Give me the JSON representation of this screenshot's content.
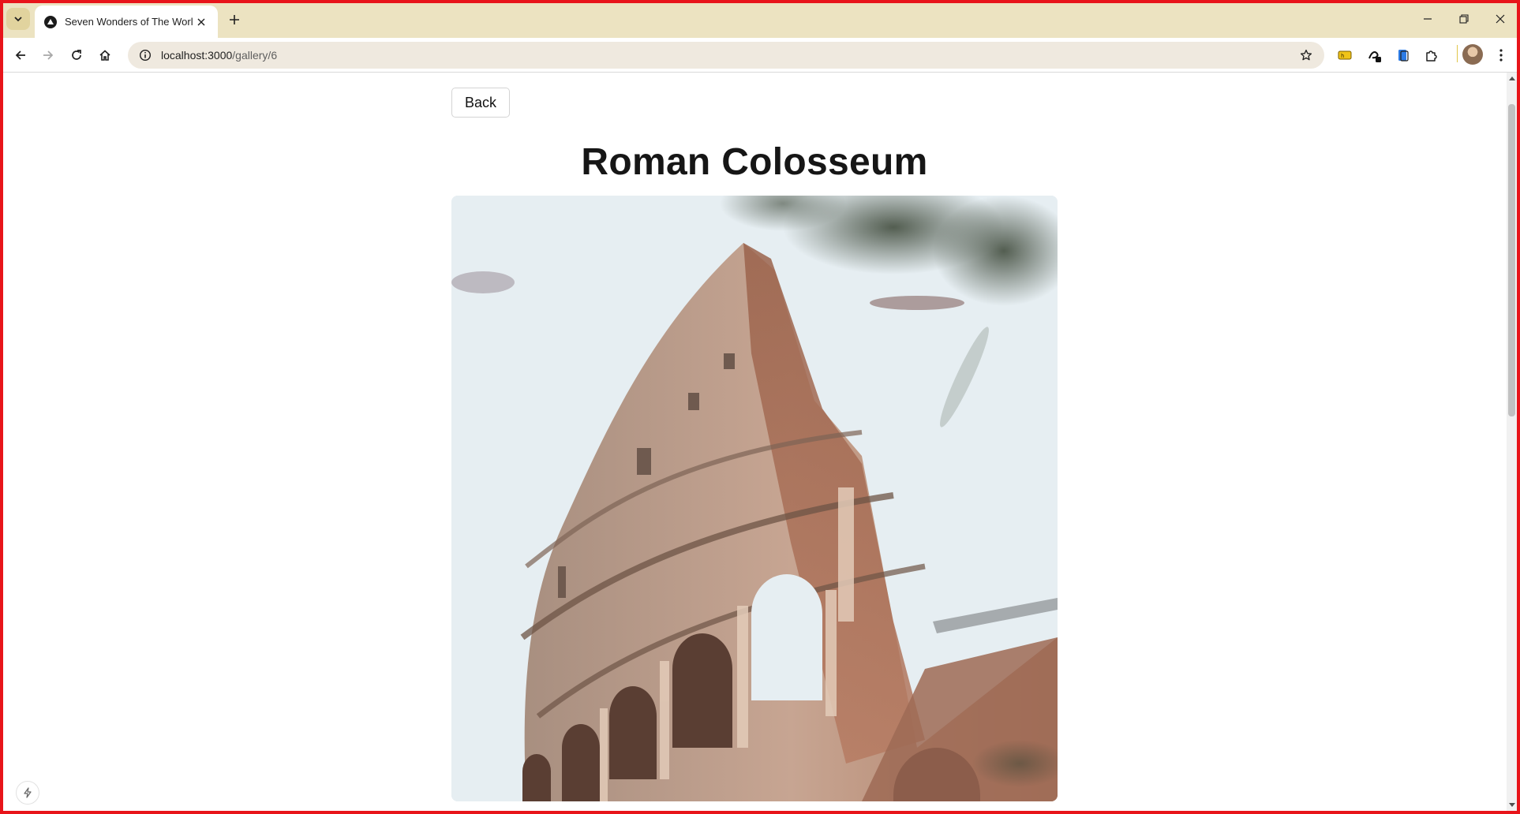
{
  "browser": {
    "tab": {
      "title": "Seven Wonders of The World"
    },
    "address": {
      "host": "localhost:3000",
      "path": "/gallery/6"
    }
  },
  "page": {
    "back_label": "Back",
    "title": "Roman Colosseum",
    "image_alt": "Roman Colosseum"
  },
  "icons": {
    "tab_search": "chevron-down-icon",
    "favicon": "nextjs-icon",
    "close": "close-icon",
    "new_tab": "plus-icon",
    "minimize": "minimize-icon",
    "restore": "restore-icon",
    "window_close": "close-icon",
    "back": "arrow-left-icon",
    "forward": "arrow-right-icon",
    "reload": "reload-icon",
    "home": "home-icon",
    "site_info": "info-icon",
    "bookmark": "star-icon",
    "extensions": "puzzle-icon",
    "menu": "kebab-menu-icon"
  },
  "colors": {
    "frame": "#e8141a",
    "tabstrip": "#ece3c1",
    "omnibox": "#efe9df"
  }
}
